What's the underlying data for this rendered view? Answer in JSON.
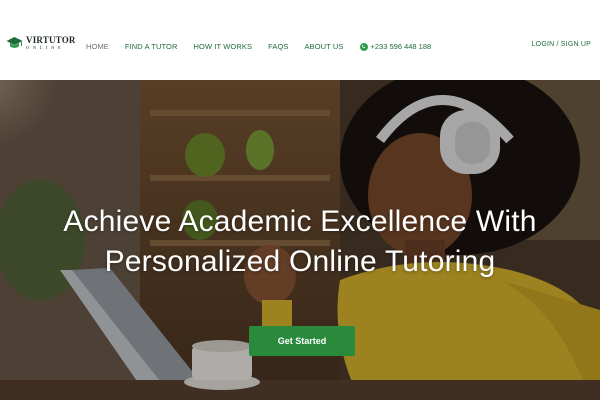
{
  "brand": {
    "name": "VIRTUTOR",
    "tagline": "ONLINE",
    "logo_icon": "graduation-cap-icon"
  },
  "nav": {
    "items": [
      {
        "label": "HOME",
        "active": true
      },
      {
        "label": "FIND A TUTOR",
        "active": false
      },
      {
        "label": "HOW IT WORKS",
        "active": false
      },
      {
        "label": "FAQS",
        "active": false
      },
      {
        "label": "ABOUT US",
        "active": false
      }
    ],
    "phone": {
      "icon": "whatsapp-icon",
      "number": "+233 596 448 188"
    },
    "login_label": "LOGIN / SIGN UP"
  },
  "hero": {
    "title_line1": "Achieve Academic Excellence With",
    "title_line2": "Personalized Online Tutoring",
    "cta_label": "Get Started"
  },
  "colors": {
    "accent_green": "#1f6b3a",
    "button_green": "#2a8a3c",
    "nav_active": "#6d6f72",
    "sweater_yellow": "#d9b62c"
  }
}
